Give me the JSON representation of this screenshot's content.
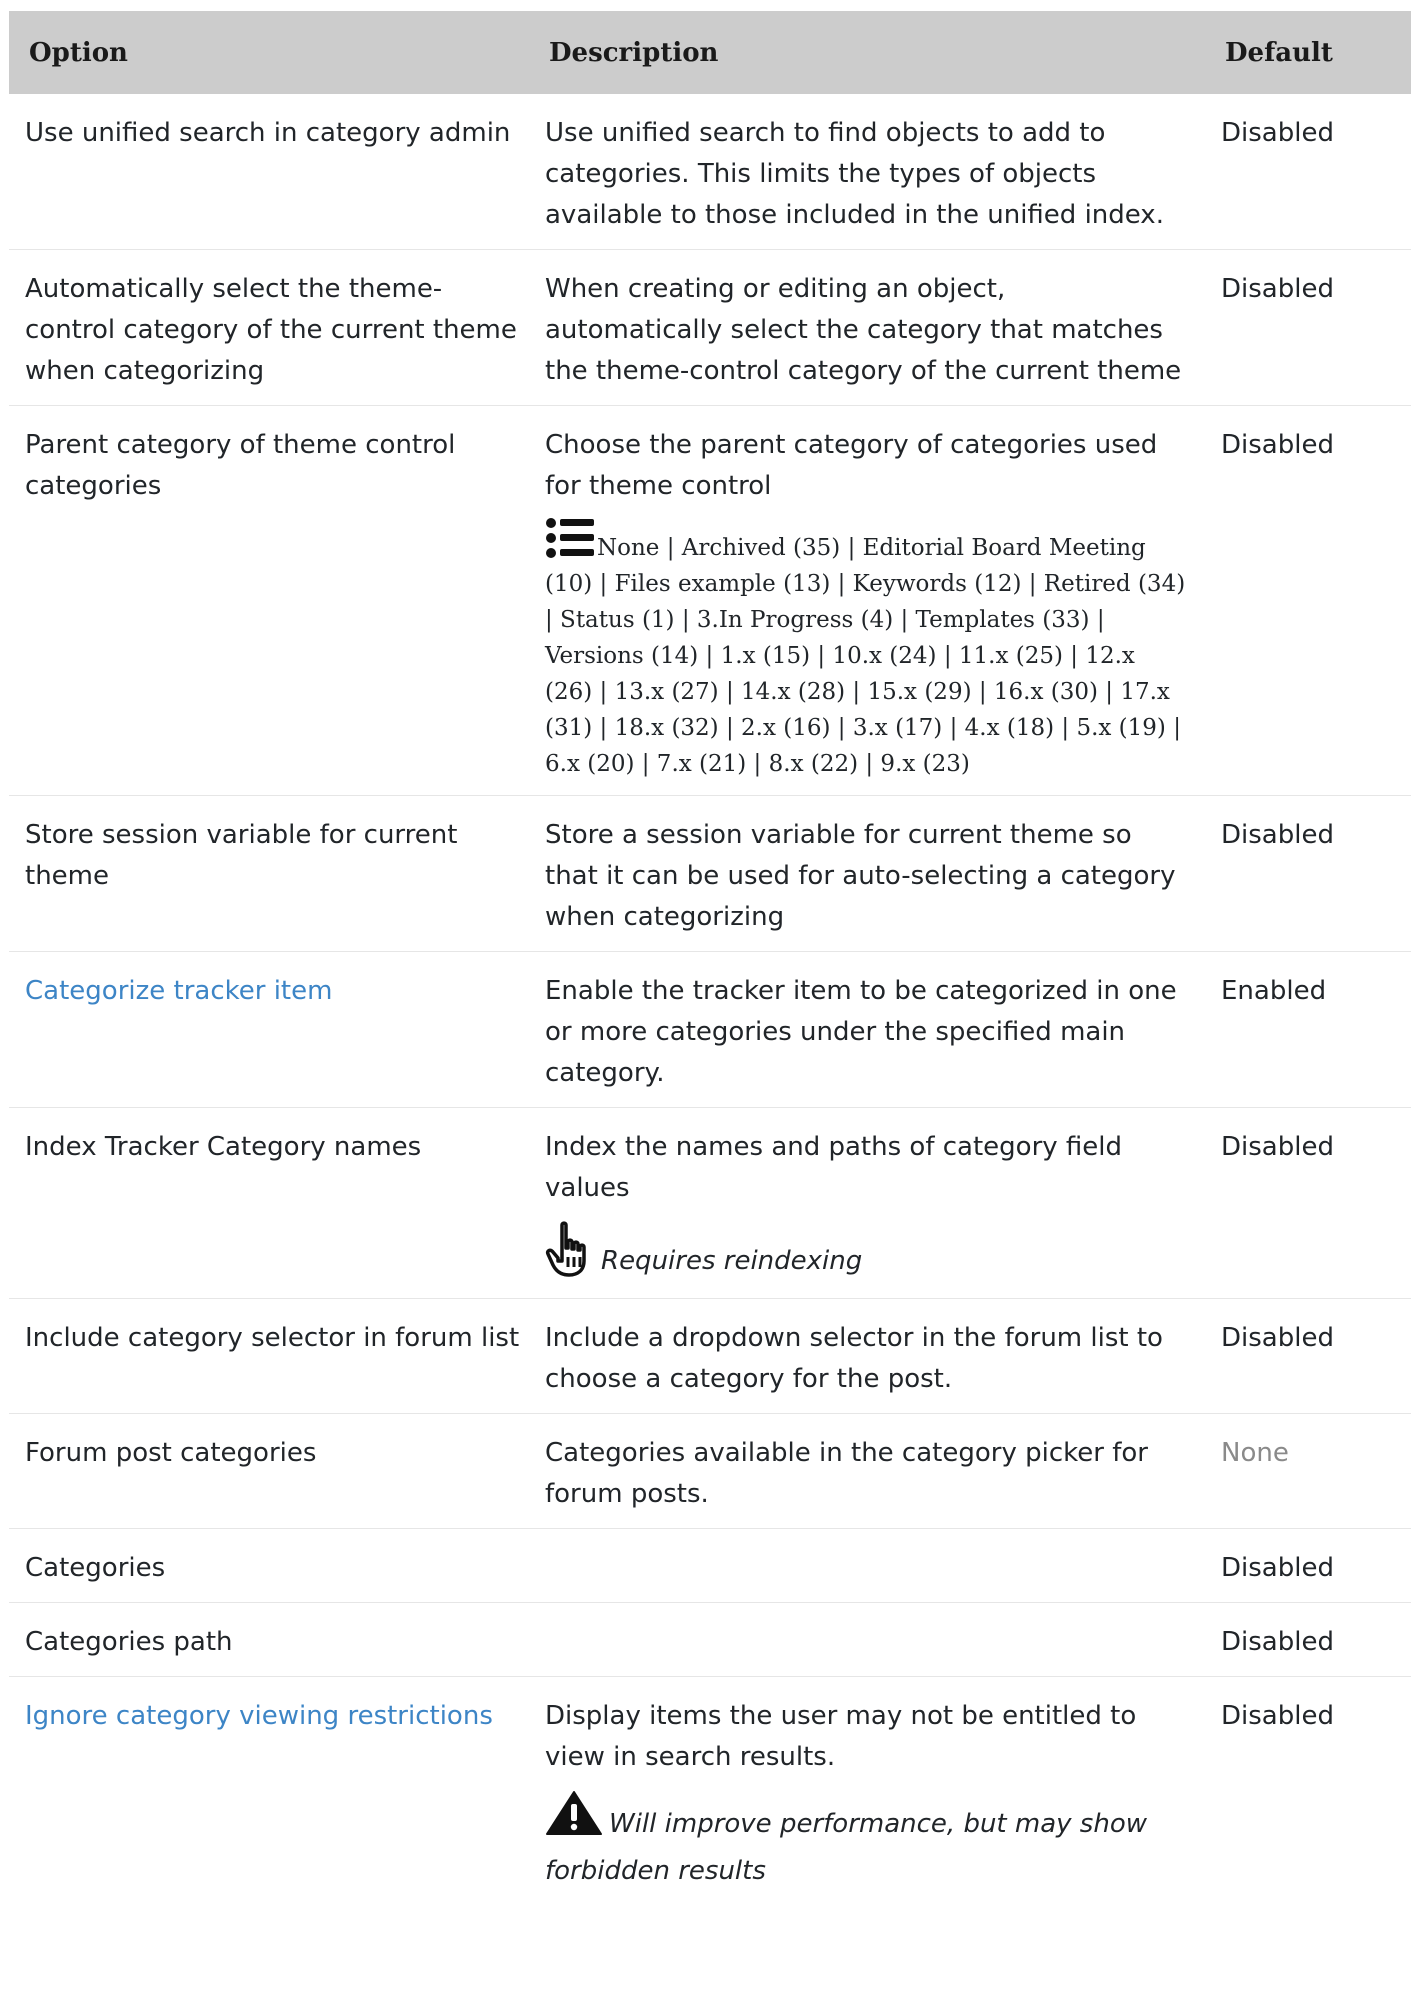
{
  "table": {
    "headers": {
      "option": "Option",
      "description": "Description",
      "default": "Default"
    },
    "rows": [
      {
        "option": "Use unified search in category admin",
        "description": "Use unified search to find objects to add to categories. This limits the types of objects available to those included in the unified index.",
        "default": "Disabled"
      },
      {
        "option": "Automatically select the theme-control category of the current theme when categorizing",
        "description": "When creating or editing an object, automatically select the category that matches the theme-control category of the current theme",
        "default": "Disabled"
      },
      {
        "option": "Parent category of theme control categories",
        "description": "Choose the parent category of categories used for theme control",
        "choices": "None | Archived (35) | Editorial Board Meeting (10) | Files example (13) | Keywords (12) | Retired (34) | Status (1) | 3.In Progress (4) | Templates (33) | Versions (14) | 1.x (15) | 10.x (24) | 11.x (25) | 12.x (26) | 13.x (27) | 14.x (28) | 15.x (29) | 16.x (30) | 17.x (31) | 18.x (32) | 2.x (16) | 3.x (17) | 4.x (18) | 5.x (19) | 6.x (20) | 7.x (21) | 8.x (22) | 9.x (23)",
        "default": "Disabled"
      },
      {
        "option": "Store session variable for current theme",
        "description": "Store a session variable for current theme so that it can be used for auto-selecting a category when categorizing",
        "default": "Disabled"
      },
      {
        "option": "Categorize tracker item",
        "description": "Enable the tracker item to be categorized in one or more categories under the specified main category.",
        "default": "Enabled"
      },
      {
        "option": "Index Tracker Category names",
        "description": "Index the names and paths of category field values",
        "note": "Requires reindexing",
        "default": "Disabled"
      },
      {
        "option": "Include category selector in forum list",
        "description": "Include a dropdown selector in the forum list to choose a category for the post.",
        "default": "Disabled"
      },
      {
        "option": "Forum post categories",
        "description": "Categories available in the category picker for forum posts.",
        "default": "None"
      },
      {
        "option": "Categories",
        "description": "",
        "default": "Disabled"
      },
      {
        "option": "Categories path",
        "description": "",
        "default": "Disabled"
      },
      {
        "option": "Ignore category viewing restrictions",
        "description": "Display items the user may not be entitled to view in search results.",
        "note": "Will improve performance, but may show forbidden results",
        "default": "Disabled"
      }
    ]
  },
  "icons": {
    "list": "list-icon",
    "reindex": "pointing-hand-icon",
    "warning": "warning-triangle-icon"
  },
  "colors": {
    "header_bg": "#cccccc",
    "link": "#3d85c6",
    "muted": "#8a8a8a"
  }
}
